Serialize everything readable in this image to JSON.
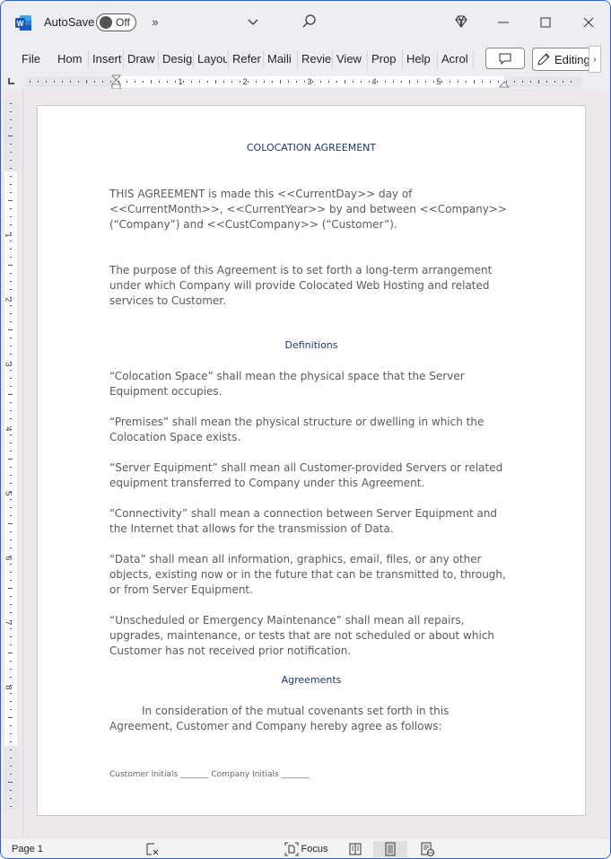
{
  "titlebar": {
    "app_icon": "word-logo-icon",
    "autosave_label": "AutoSave",
    "autosave_state": "Off",
    "overflow_icon": "»",
    "customize_icon": "chevron-down-icon",
    "search_icon": "search-icon",
    "premium_icon": "diamond-icon",
    "minimize_icon": "minimize-icon",
    "maximize_icon": "maximize-icon",
    "close_icon": "close-icon"
  },
  "ribbon": {
    "tabs": [
      "File",
      "Home",
      "Insert",
      "Draw",
      "Design",
      "Layout",
      "References",
      "Mailings",
      "Review",
      "View",
      "Properties",
      "Help",
      "Acrobat"
    ],
    "tabs_visible": [
      "File",
      "Hom",
      "Insert",
      "Draw",
      "Desig",
      "Layou",
      "Refer",
      "Maili",
      "Revie",
      "View",
      "Prop",
      "Help",
      "Acrol"
    ],
    "comment_icon": "comment-icon",
    "editing_label": "Editing",
    "editing_icon": "pencil-icon",
    "more_label": "›"
  },
  "ruler": {
    "numbers": [
      "1",
      "2",
      "3",
      "4",
      "5"
    ],
    "vertical_numbers": [
      "1",
      "2",
      "3",
      "4",
      "5",
      "6",
      "7",
      "8"
    ]
  },
  "document": {
    "title": "COLOCATION AGREEMENT",
    "intro": "THIS AGREEMENT is made this <<CurrentDay>> day of <<CurrentMonth>>, <<CurrentYear>> by and between <<Company>> (“Company”) and <<CustCompany>> (“Customer”).",
    "purpose": "The purpose of this Agreement is to set forth a long-term arrangement under which Company will provide Colocated Web Hosting and related services to Customer.",
    "definitions_heading": "Definitions",
    "definitions": [
      "“Colocation Space” shall mean the physical space that the Server Equipment occupies.",
      "“Premises” shall mean the physical structure or dwelling in which the Colocation Space exists.",
      "“Server Equipment” shall mean all Customer-provided Servers or related equipment transferred to Company under this Agreement.",
      "“Connectivity” shall mean a connection between Server Equipment and the Internet that allows for the transmission of Data.",
      "“Data” shall mean all information, graphics, email, files, or any other objects, existing now or in the future that can be transmitted to, through, or from Server Equipment.",
      "“Unscheduled or Emergency Maintenance” shall mean all repairs, upgrades, maintenance, or tests that are not scheduled or about which Customer has not received prior notification."
    ],
    "agreements_heading": "Agreements",
    "agreements_intro": "In consideration of the mutual covenants set forth in this Agreement, Customer and Company hereby agree as follows:",
    "initials_line": "Customer Initials _______  Company Initials _______"
  },
  "statusbar": {
    "page": "Page 1",
    "proofing_icon": "proofing-icon",
    "focus_label": "Focus",
    "focus_icon": "focus-icon",
    "read_mode_icon": "read-mode-icon",
    "print_layout_icon": "print-layout-icon",
    "web_layout_icon": "web-layout-icon"
  }
}
